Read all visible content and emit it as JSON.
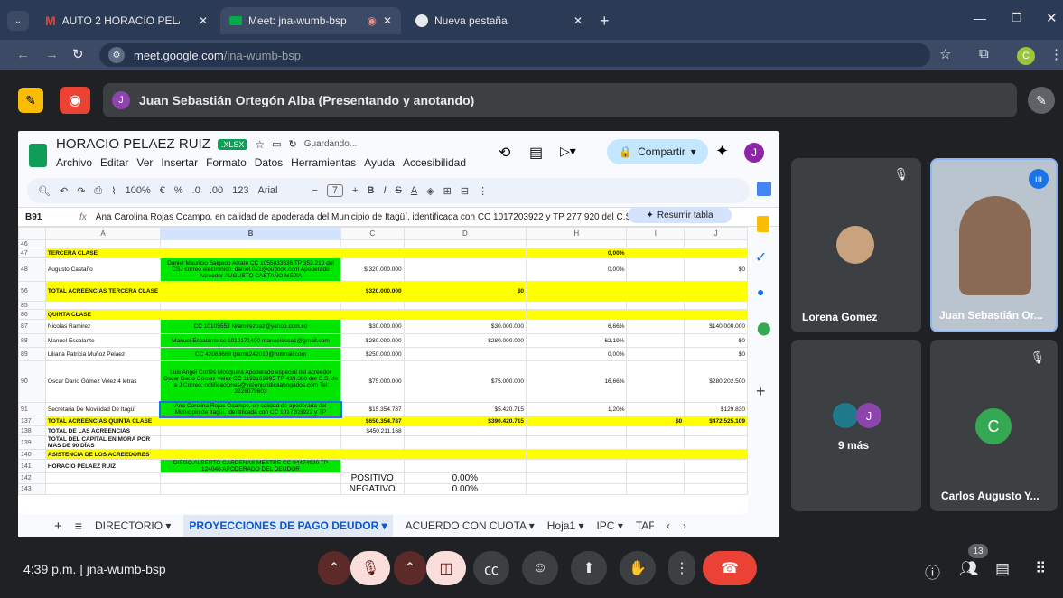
{
  "browser": {
    "tabs": [
      {
        "label": "AUTO 2 HORACIO PELAEZ RUIZ",
        "icon": "gmail-icon"
      },
      {
        "label": "Meet: jna-wumb-bsp",
        "icon": "meet-icon"
      },
      {
        "label": "Nueva pestaña",
        "icon": "chrome-icon"
      }
    ],
    "url_host": "meet.google.com",
    "url_path": "/jna-wumb-bsp",
    "profile_letter": "C"
  },
  "meet": {
    "presenter_label": "Juan Sebastián Ortegón Alba (Presentando y anotando)",
    "presenter_initial": "J",
    "participants": [
      {
        "name": "Lorena Gomez",
        "muted": true
      },
      {
        "name": "Juan Sebastián Or...",
        "muted": false
      },
      {
        "name": "9 más",
        "initial": "J"
      },
      {
        "name": "Carlos Augusto Y...",
        "initial": "C",
        "muted": true
      }
    ],
    "time": "4:39 p.m.",
    "meeting_code": "jna-wumb-bsp",
    "participant_count": "13"
  },
  "sheet": {
    "title": "HORACIO PELAEZ RUIZ",
    "badge": ".XLSX",
    "status": "Guardando...",
    "menu": [
      "Archivo",
      "Editar",
      "Ver",
      "Insertar",
      "Formato",
      "Datos",
      "Herramientas",
      "Ayuda",
      "Accesibilidad"
    ],
    "share_label": "Compartir",
    "user_initial": "J",
    "zoom": "100%",
    "font": "Arial",
    "font_size": "7",
    "cell_ref": "B91",
    "formula": "Ana Carolina Rojas Ocampo, en calidad de apoderada del Municipio de Itagüí, identificada con CC 1017203922 y TP 277.920 del C.S.J",
    "summary_label": "Resumir tabla",
    "columns": [
      "A",
      "B",
      "C",
      "D",
      "H",
      "I",
      "J"
    ],
    "rows": [
      {
        "n": "46",
        "cells": [
          "",
          "",
          "",
          "",
          "",
          "",
          ""
        ]
      },
      {
        "n": "47",
        "cls": "y",
        "cells": [
          "TERCERA CLASE",
          "",
          "",
          "",
          "0,00%",
          "",
          ""
        ]
      },
      {
        "n": "48",
        "cells": [
          "Augusto Castaño",
          "Daniel Mauricio Salgado Alzate CC 1055833636 TP 353.210 del CSJ correo electronico: daniel.021@outlook.com Apoderado Acreedor AUGUSTO CASTAÑO MEJIA",
          "$ 320.000.000",
          "",
          "0,00%",
          "",
          "$0"
        ]
      },
      {
        "n": "56",
        "cls": "y",
        "cells": [
          "TOTAL ACREENCIAS TERCERA CLASE",
          "",
          "$320.000.000",
          "$0",
          "",
          "",
          ""
        ]
      },
      {
        "n": "85",
        "cells": [
          "",
          "",
          "",
          "",
          "",
          "",
          ""
        ]
      },
      {
        "n": "86",
        "cls": "y",
        "cells": [
          "QUINTA CLASE",
          "",
          "",
          "",
          "",
          "",
          ""
        ]
      },
      {
        "n": "87",
        "cells": [
          "Nicolas Ramirez",
          "CC 10105553 Nramirezpaz@yahoo.com.co",
          "$30.000.000",
          "$30.000.000",
          "6,66%",
          "",
          "$140.000.000"
        ]
      },
      {
        "n": "88",
        "cells": [
          "Manuel Escalante",
          "Manuel Escalante cc 1010171400 manuelesca1@gmail.com",
          "$280.000.000",
          "$280.000.000",
          "62,19%",
          "",
          "$0"
        ]
      },
      {
        "n": "89",
        "cells": [
          "Liliana Patricia Muñoz Pelaez",
          "CC 42063669 lpamu242010@hotmail.com",
          "$250.000.000",
          "",
          "0,00%",
          "",
          "$0"
        ]
      },
      {
        "n": "90",
        "cells": [
          "Oscar Darío Gómez Velez 4 letras",
          "Luis Angel Cortés Mosquera Apoderado especial del acreedor Oscar Darío Gómez Velez CC 1192169995 TP 439.380 del C.S. de la J Correo: notificaciones@visionjuridicaabogados.com Tel: 3226079603",
          "$75.000.000",
          "$75.000.000",
          "16,66%",
          "",
          "$280.202.500"
        ]
      },
      {
        "n": "91",
        "cells": [
          "Secretaria De Movilidad De Itagüí",
          "Ana Carolina Rojas Ocampo, en calidad de apoderada del Municipio de Itagüí, identificada con CC 1017203922 y TP",
          "$15.354.787",
          "$5.420.715",
          "1,20%",
          "",
          "$129.830"
        ]
      },
      {
        "n": "137",
        "cls": "y",
        "cells": [
          "TOTAL ACREENCIAS QUINTA CLASE",
          "",
          "$650.354.787",
          "$390.420.715",
          "",
          "$0",
          "$472.525.109"
        ]
      },
      {
        "n": "138",
        "cells": [
          "TOTAL DE LAS ACREENCIAS",
          "",
          "$450.211.168",
          "",
          "",
          "",
          ""
        ]
      },
      {
        "n": "139",
        "cells": [
          "TOTAL DEL CAPITAL EN MORA POR MAS DE 90 DÍAS",
          "",
          "",
          "",
          "",
          "",
          ""
        ]
      },
      {
        "n": "140",
        "cls": "y",
        "cells": [
          "ASISTENCIA DE LOS ACREEDORES",
          "",
          "",
          "",
          "",
          "",
          ""
        ]
      },
      {
        "n": "141",
        "cells": [
          "HORACIO PELAEZ RUIZ",
          "DIEGO ALBERTO CARDENAS MESTRE CC 94474920 TP 124048 APODERADO DEL DEUDOR",
          "",
          "",
          "",
          "",
          ""
        ]
      },
      {
        "n": "142",
        "cells": [
          "",
          "",
          "POSITIVO",
          "0,00%",
          "",
          "",
          ""
        ]
      },
      {
        "n": "143",
        "cells": [
          "",
          "",
          "NEGATIVO",
          "0.00%",
          "",
          "",
          ""
        ]
      }
    ],
    "sheet_tabs": [
      "DIRECTORIO",
      "PROYECCIONES DE PAGO DEUDOR",
      "ACUERDO CON CUOTA",
      "Hoja1",
      "IPC",
      "TAF"
    ]
  },
  "colors": {
    "accent": "#1a73e8",
    "end_call": "#ea4335",
    "yellow": "#ffff00",
    "green": "#00e600"
  }
}
